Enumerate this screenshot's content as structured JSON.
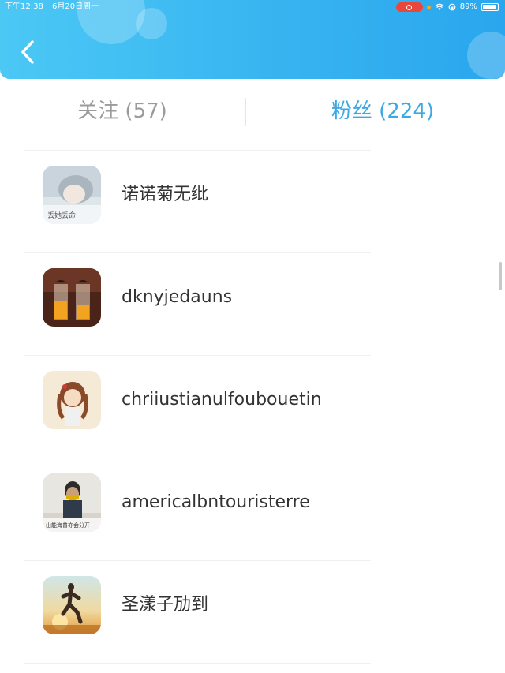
{
  "status_bar": {
    "time": "下午12:38",
    "date": "6月20日周一",
    "battery": "89%",
    "battery_level": 0.89
  },
  "header": {
    "back_icon": "chevron-left-icon"
  },
  "tabs": [
    {
      "label": "关注 (57)",
      "active": false
    },
    {
      "label": "粉丝 (224)",
      "active": true
    }
  ],
  "fans": [
    {
      "name": "诺诺菊无纰",
      "avatar_caption": "丢她丢命"
    },
    {
      "name": "dknyjedauns",
      "avatar_caption": ""
    },
    {
      "name": "chriiustianulfoubouetin",
      "avatar_caption": ""
    },
    {
      "name": "americalbntouristerre",
      "avatar_caption": "山能海普亦会分开"
    },
    {
      "name": "圣漾子劢到",
      "avatar_caption": ""
    }
  ],
  "colors": {
    "header": "#37b4f0",
    "active_tab": "#3aa9e4",
    "inactive_tab": "#9b9b9b",
    "name_text": "#333333"
  }
}
